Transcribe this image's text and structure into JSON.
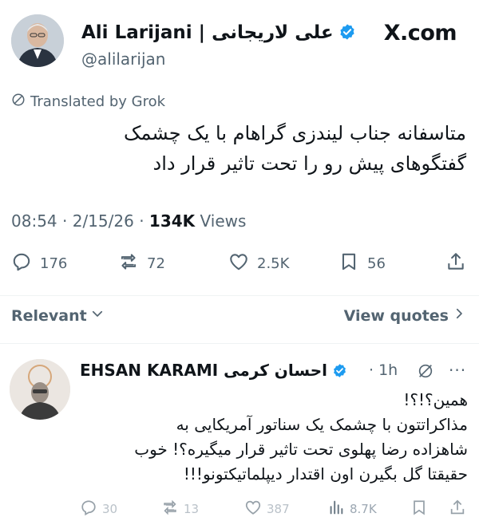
{
  "header": {
    "author_name": "Ali Larijani | علی لاریجانی",
    "handle": "@alilarijan",
    "site": "X.com"
  },
  "tweet": {
    "translated_label": "Translated by Grok",
    "text_line1": "متاسفانه جناب لیندزی گراهام با یک چشمک",
    "text_line2": "گفتگوهای پیش رو را تحت تاثیر قرار داد",
    "time": "08:54",
    "date": "2/15/26",
    "views_count": "134K",
    "views_label": "Views",
    "sep1": "·",
    "sep2": "·"
  },
  "actions": {
    "replies": "176",
    "reposts": "72",
    "likes": "2.5K",
    "bookmarks": "56"
  },
  "sort": {
    "relevant_label": "Relevant",
    "view_quotes_label": "View quotes"
  },
  "reply": {
    "author_name": "EHSAN KARAMI احسان کرمی",
    "sep": "·",
    "time": "1h",
    "more": "···",
    "lines": [
      "همین؟!؟!",
      "مذاکراتتون با چشمک یک سناتور آمریکایی به",
      "شاهزاده رضا پهلوی تحت تاثیر قرار میگیره؟! خوب",
      "حقیقتا گل بگیرن اون اقتدار دیپلماتیکتونو!!!"
    ],
    "actions": {
      "replies": "30",
      "reposts": "13",
      "likes": "387",
      "views": "8.7K"
    }
  },
  "colors": {
    "text": "#0f1419",
    "secondary": "#536471",
    "verified": "#1d9bf0",
    "divider": "#eff3f4"
  }
}
